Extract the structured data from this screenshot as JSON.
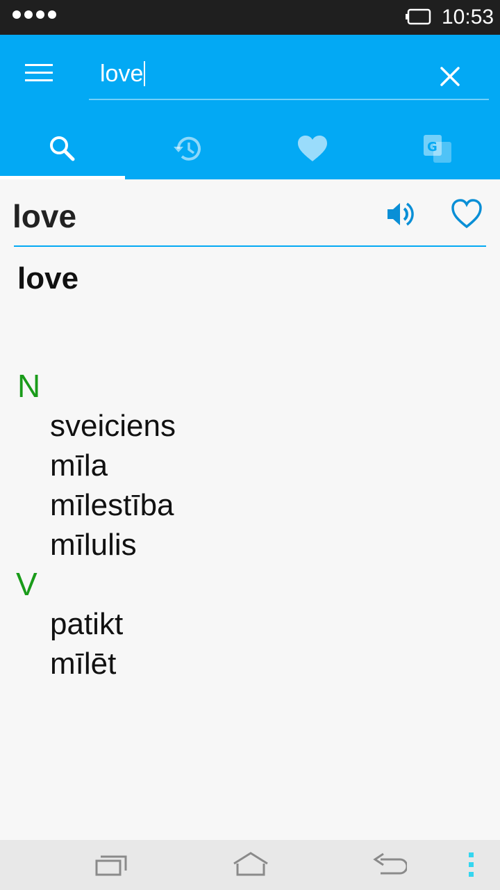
{
  "status": {
    "time": "10:53"
  },
  "search": {
    "query": "love"
  },
  "tabs": [
    {
      "name": "search",
      "icon": "search-icon",
      "active": true
    },
    {
      "name": "history",
      "icon": "history-icon",
      "active": false
    },
    {
      "name": "favorites",
      "icon": "heart-icon",
      "active": false
    },
    {
      "name": "translate",
      "icon": "translate-icon",
      "active": false
    }
  ],
  "entry": {
    "headword": "love",
    "title": "love",
    "groups": [
      {
        "pos": "N",
        "translations": [
          "sveiciens",
          "mīla",
          "mīlestība",
          "mīlulis"
        ]
      },
      {
        "pos": "V",
        "translations": [
          "patikt",
          "mīlēt"
        ]
      }
    ]
  },
  "colors": {
    "accent": "#03a9f4",
    "pos_label": "#1a9b1a",
    "status_bar": "#1f1f1f"
  }
}
